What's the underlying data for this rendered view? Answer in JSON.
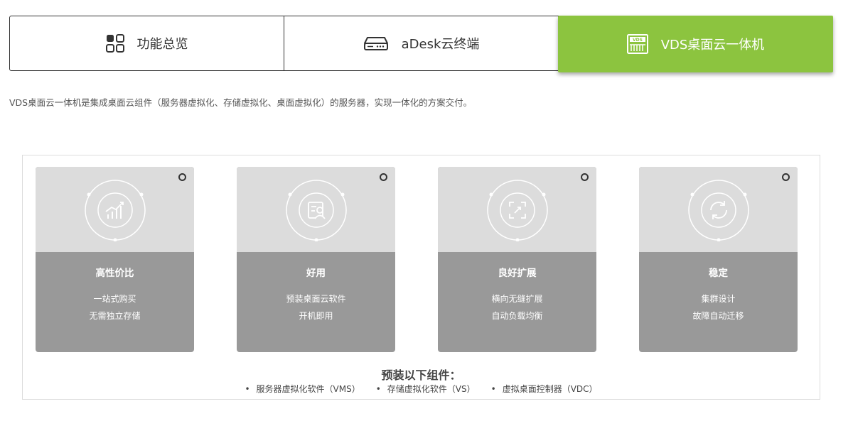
{
  "tabs": [
    {
      "label": "功能总览",
      "icon": "grid-icon",
      "active": false
    },
    {
      "label": "aDesk云终端",
      "icon": "terminal-device-icon",
      "active": false
    },
    {
      "label": "VDS桌面云一体机",
      "icon": "vds-server-icon",
      "active": true
    }
  ],
  "intro": "VDS桌面云一体机是集成桌面云组件（服务器虚拟化、存储虚拟化、桌面虚拟化）的服务器，实现一体化的方案交付。",
  "cards": [
    {
      "title": "高性价比",
      "line1": "一站式购买",
      "line2": "无需独立存储",
      "icon": "chart-trend-icon"
    },
    {
      "title": "好用",
      "line1": "预装桌面云软件",
      "line2": "开机即用",
      "icon": "user-document-icon"
    },
    {
      "title": "良好扩展",
      "line1": "横向无缝扩展",
      "line2": "自动负载均衡",
      "icon": "expand-icon"
    },
    {
      "title": "稳定",
      "line1": "集群设计",
      "line2": "故障自动迁移",
      "icon": "refresh-cycle-icon"
    }
  ],
  "components": {
    "heading": "预装以下组件：",
    "items": [
      "服务器虚拟化软件（VMS）",
      "存储虚拟化软件（VS）",
      "虚拟桌面控制器（VDC）"
    ]
  },
  "colors": {
    "accent": "#8cc43f",
    "card_top": "#dcdcdc",
    "card_bottom": "#999999"
  }
}
